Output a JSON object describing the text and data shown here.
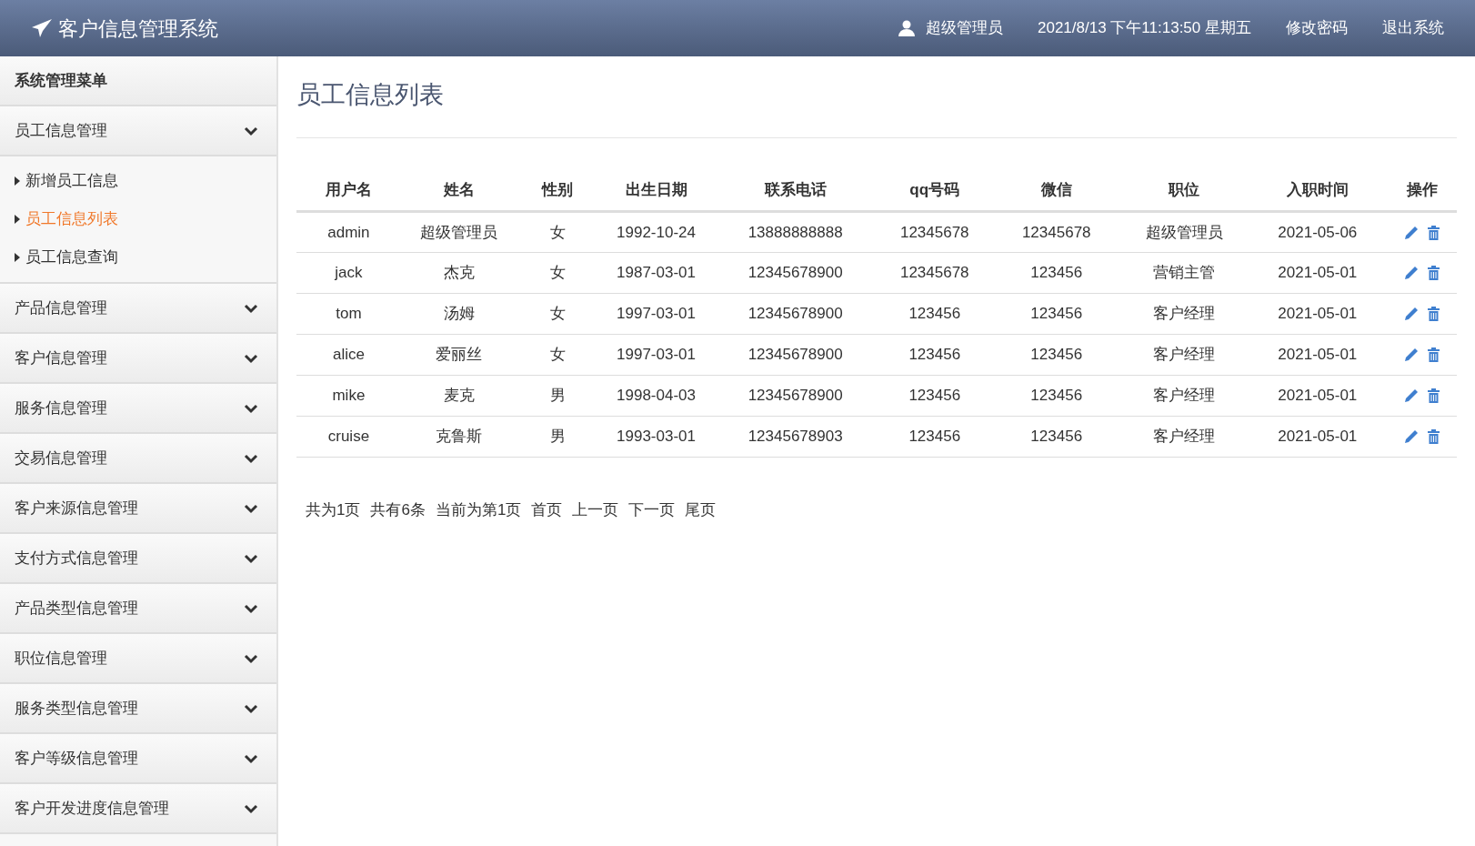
{
  "header": {
    "title": "客户信息管理系统",
    "user": "超级管理员",
    "datetime": "2021/8/13 下午11:13:50 星期五",
    "links": [
      "修改密码",
      "退出系统"
    ]
  },
  "sidebar": {
    "title": "系统管理菜单",
    "groups": [
      {
        "label": "员工信息管理",
        "children": [
          {
            "label": "新增员工信息",
            "selected": false
          },
          {
            "label": "员工信息列表",
            "selected": true
          },
          {
            "label": "员工信息查询",
            "selected": false
          }
        ]
      },
      {
        "label": "产品信息管理"
      },
      {
        "label": "客户信息管理"
      },
      {
        "label": "服务信息管理"
      },
      {
        "label": "交易信息管理"
      },
      {
        "label": "客户来源信息管理"
      },
      {
        "label": "支付方式信息管理"
      },
      {
        "label": "产品类型信息管理"
      },
      {
        "label": "职位信息管理"
      },
      {
        "label": "服务类型信息管理"
      },
      {
        "label": "客户等级信息管理"
      },
      {
        "label": "客户开发进度信息管理"
      }
    ]
  },
  "page_title": "员工信息列表",
  "table": {
    "columns": [
      "用户名",
      "姓名",
      "性别",
      "出生日期",
      "联系电话",
      "qq号码",
      "微信",
      "职位",
      "入职时间",
      "操作"
    ],
    "rows": [
      [
        "admin",
        "超级管理员",
        "女",
        "1992-10-24",
        "13888888888",
        "12345678",
        "12345678",
        "超级管理员",
        "2021-05-06"
      ],
      [
        "jack",
        "杰克",
        "女",
        "1987-03-01",
        "12345678900",
        "12345678",
        "123456",
        "营销主管",
        "2021-05-01"
      ],
      [
        "tom",
        "汤姆",
        "女",
        "1997-03-01",
        "12345678900",
        "123456",
        "123456",
        "客户经理",
        "2021-05-01"
      ],
      [
        "alice",
        "爱丽丝",
        "女",
        "1997-03-01",
        "12345678900",
        "123456",
        "123456",
        "客户经理",
        "2021-05-01"
      ],
      [
        "mike",
        "麦克",
        "男",
        "1998-04-03",
        "12345678900",
        "123456",
        "123456",
        "客户经理",
        "2021-05-01"
      ],
      [
        "cruise",
        "克鲁斯",
        "男",
        "1993-03-01",
        "12345678903",
        "123456",
        "123456",
        "客户经理",
        "2021-05-01"
      ]
    ]
  },
  "pagination": {
    "info": [
      "共为1页",
      "共有6条",
      "当前为第1页"
    ],
    "links": [
      "首页",
      "上一页",
      "下一页",
      "尾页"
    ]
  }
}
